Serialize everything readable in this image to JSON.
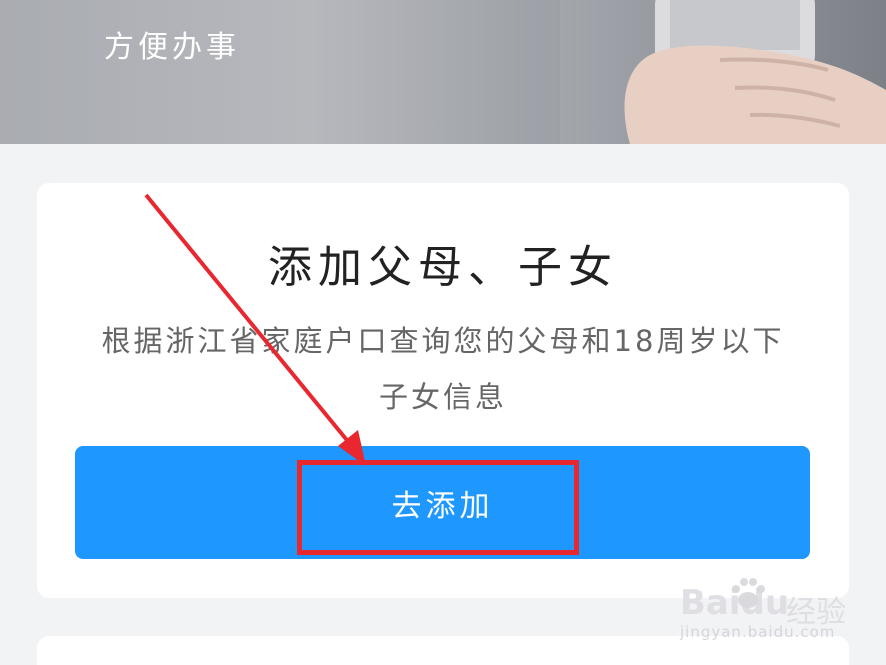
{
  "banner": {
    "title": "方便办事"
  },
  "card": {
    "title": "添加父母、子女",
    "description": "根据浙江省家庭户口查询您的父母和18周岁以下子女信息",
    "button_label": "去添加"
  },
  "watermark": {
    "logo": "Baidu",
    "brand": "经验",
    "url": "jingyan.baidu.com"
  },
  "colors": {
    "button": "#1e98ff",
    "annotation": "#e8272f",
    "background": "#f2f3f5"
  }
}
